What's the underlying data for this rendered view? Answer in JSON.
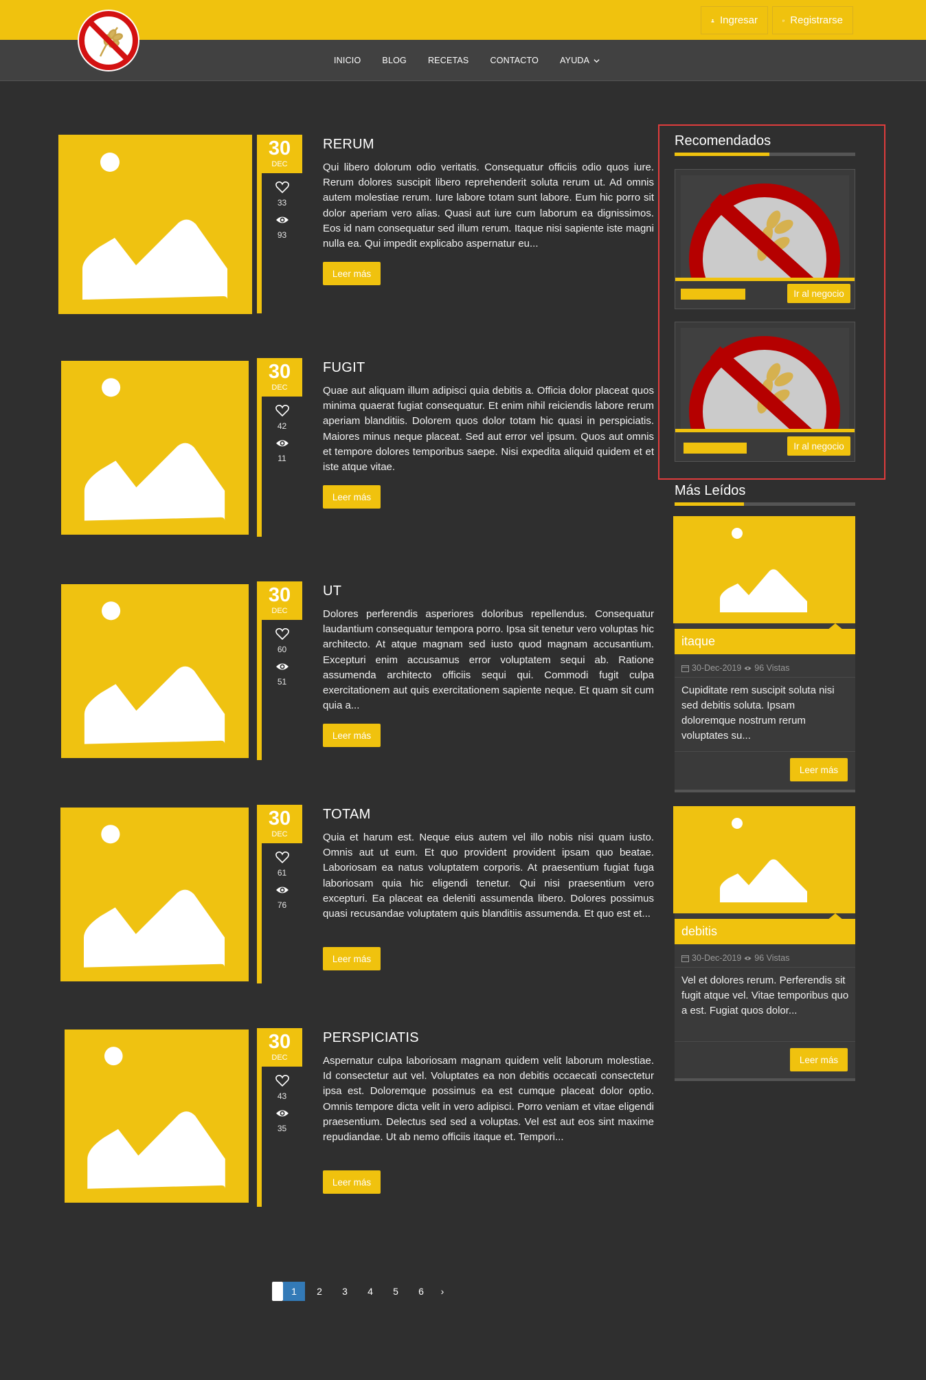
{
  "header": {
    "login_label": "Ingresar",
    "register_label": "Registrarse",
    "logo_icon": "no-gluten-logo-icon"
  },
  "nav": {
    "items": [
      "INICIO",
      "BLOG",
      "RECETAS",
      "CONTACTO",
      "AYUDA"
    ]
  },
  "articles": [
    {
      "title": "RERUM",
      "day": "30",
      "month": "DEC",
      "likes": "33",
      "views": "93",
      "text": "Qui libero dolorum odio veritatis. Consequatur officiis odio quos iure. Rerum dolores suscipit libero reprehenderit soluta rerum ut. Ad omnis autem molestiae rerum. Iure labore totam sunt labore. Eum hic porro sit dolor aperiam vero alias. Quasi aut iure cum laborum ea dignissimos. Eos id nam consequatur sed illum rerum. Itaque nisi sapiente iste magni nulla ea. Qui impedit explicabo aspernatur eu...",
      "button": "Leer más"
    },
    {
      "title": "FUGIT",
      "day": "30",
      "month": "DEC",
      "likes": "42",
      "views": "11",
      "text": "Quae aut aliquam illum adipisci quia debitis a. Officia dolor placeat quos minima quaerat fugiat consequatur. Et enim nihil reiciendis labore rerum aperiam blanditiis. Dolorem quos dolor totam hic quasi in perspiciatis. Maiores minus neque placeat. Sed aut error vel ipsum. Quos aut omnis et tempore dolores temporibus saepe. Nisi expedita aliquid quidem et et iste atque vitae.",
      "button": "Leer más"
    },
    {
      "title": "UT",
      "day": "30",
      "month": "DEC",
      "likes": "60",
      "views": "51",
      "text": "Dolores perferendis asperiores doloribus repellendus. Consequatur laudantium consequatur tempora porro. Ipsa sit tenetur vero voluptas hic architecto. At atque magnam sed iusto quod magnam accusantium. Excepturi enim accusamus error voluptatem sequi ab. Ratione assumenda architecto officiis sequi qui. Commodi fugit culpa exercitationem aut quis exercitationem sapiente neque. Et quam sit cum quia a...",
      "button": "Leer más"
    },
    {
      "title": "TOTAM",
      "day": "30",
      "month": "DEC",
      "likes": "61",
      "views": "76",
      "text": "Quia et harum est. Neque eius autem vel illo nobis nisi quam iusto. Omnis aut ut eum. Et quo provident provident ipsam quo beatae. Laboriosam ea natus voluptatem corporis. At praesentium fugiat fuga laboriosam quia hic eligendi tenetur. Qui nisi praesentium vero excepturi. Ea placeat ea deleniti assumenda libero. Dolores possimus quasi recusandae voluptatem quis blanditiis assumenda. Et quo est et...",
      "button": "Leer más"
    },
    {
      "title": "PERSPICIATIS",
      "day": "30",
      "month": "DEC",
      "likes": "43",
      "views": "35",
      "text": "Aspernatur culpa laboriosam magnam quidem velit laborum molestiae. Id consectetur aut vel. Voluptates ea non debitis occaecati consectetur ipsa est. Doloremque possimus ea est cumque placeat dolor optio. Omnis tempore dicta velit in vero adipisci. Porro veniam et vitae eligendi praesentium. Delectus sed sed a voluptas. Vel est aut eos sint maxime repudiandae. Ut ab nemo officiis itaque et. Tempori...",
      "button": "Leer más"
    }
  ],
  "sidebar": {
    "recommended_title": "Recomendados",
    "recommended": [
      {
        "button": "Ir al negocio"
      },
      {
        "button": "Ir al negocio"
      }
    ],
    "most_read_title": "Más Leídos",
    "most_read": [
      {
        "title": "itaque",
        "date": "30-Dec-2019",
        "views": "96 Vistas",
        "text": "Cupiditate rem suscipit soluta nisi sed debitis soluta. Ipsam doloremque nostrum rerum voluptates su...",
        "button": "Leer más"
      },
      {
        "title": "debitis",
        "date": "30-Dec-2019",
        "views": "96 Vistas",
        "text": "Vel et dolores rerum. Perferendis sit fugit atque vel. Vitae temporibus quo a est. Fugiat quos dolor...",
        "button": "Leer más"
      }
    ]
  },
  "pagination": {
    "pages": [
      "1",
      "2",
      "3",
      "4",
      "5",
      "6"
    ],
    "next": "›",
    "active": "1"
  },
  "colors": {
    "accent": "#f0c20e",
    "background": "#2f2f2f",
    "navbar": "#414141",
    "highlight_border": "#e03c3c",
    "pagination_active": "#337ab7"
  }
}
